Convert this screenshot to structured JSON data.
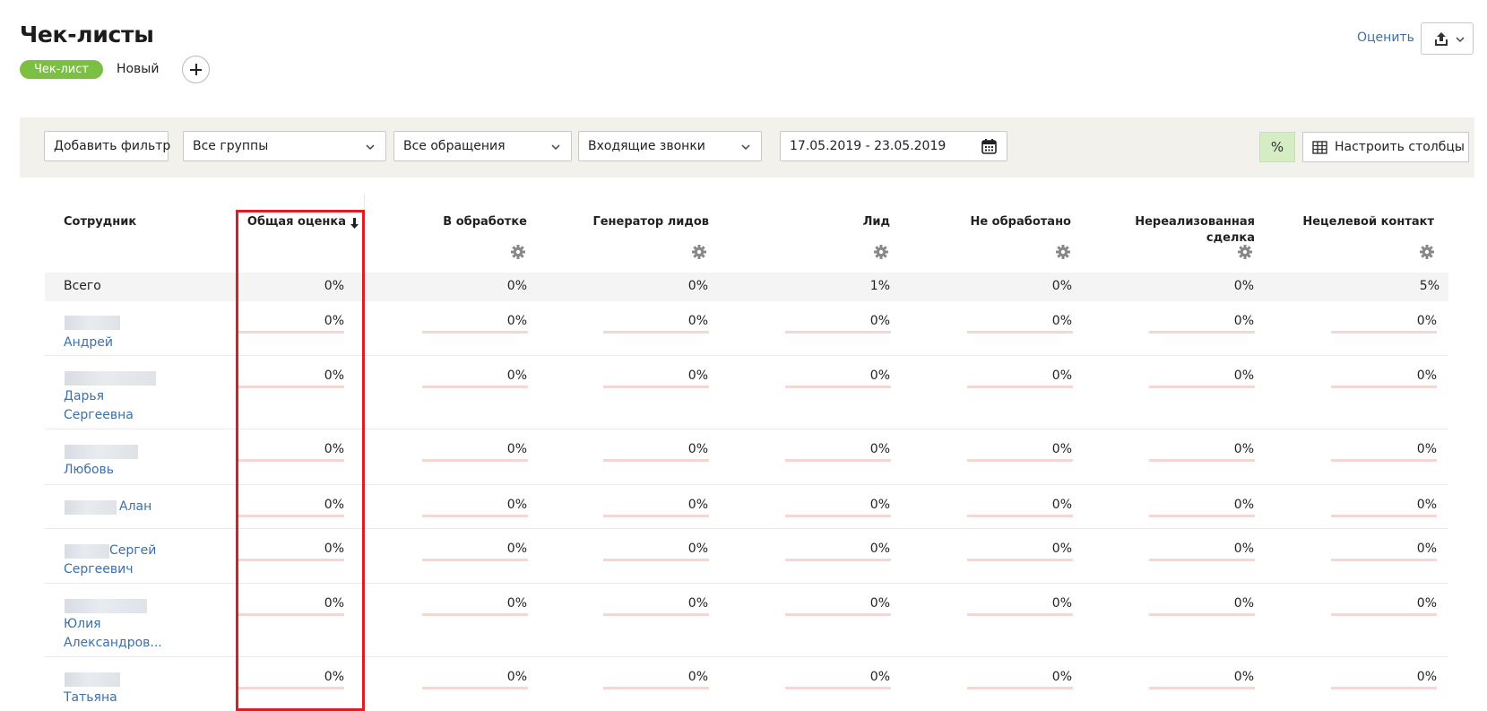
{
  "page": {
    "title": "Чек-листы",
    "tab_active": "Чек-лист",
    "tab_new": "Новый"
  },
  "header_actions": {
    "rate_label": "Оценить",
    "export_icon": "share-export-icon"
  },
  "filters": {
    "add_filter": "Добавить фильтр",
    "groups": "Все группы",
    "requests": "Все обращения",
    "call_type": "Входящие звонки",
    "date_range": "17.05.2019 - 23.05.2019",
    "percent": "%",
    "configure_columns": "Настроить столбцы"
  },
  "table": {
    "employee_header": "Сотрудник",
    "overall_header": "Общая оценка",
    "columns": [
      "В обработке",
      "Генератор лидов",
      "Лид",
      "Не обработано",
      "Нереализованная сделка",
      "Нецелевой контакт"
    ],
    "total": {
      "label": "Всего",
      "overall": "0%",
      "values": [
        "0%",
        "0%",
        "1%",
        "0%",
        "0%",
        "5%"
      ]
    },
    "rows": [
      {
        "name": "Андрей",
        "overall": "0%",
        "values": [
          "0%",
          "0%",
          "0%",
          "0%",
          "0%",
          "0%"
        ]
      },
      {
        "name": "Дарья",
        "name2": "Сергеевна",
        "overall": "0%",
        "values": [
          "0%",
          "0%",
          "0%",
          "0%",
          "0%",
          "0%"
        ]
      },
      {
        "name": "Любовь",
        "overall": "0%",
        "values": [
          "0%",
          "0%",
          "0%",
          "0%",
          "0%",
          "0%"
        ]
      },
      {
        "name": "Алан",
        "overall": "0%",
        "values": [
          "0%",
          "0%",
          "0%",
          "0%",
          "0%",
          "0%"
        ]
      },
      {
        "name": "Сергей",
        "name2": "Сергеевич",
        "overall": "0%",
        "values": [
          "0%",
          "0%",
          "0%",
          "0%",
          "0%",
          "0%"
        ]
      },
      {
        "name": "Юлия",
        "name2": "Александров...",
        "overall": "0%",
        "values": [
          "0%",
          "0%",
          "0%",
          "0%",
          "0%",
          "0%"
        ]
      },
      {
        "name": "Татьяна",
        "overall": "0%",
        "values": [
          "0%",
          "0%",
          "0%",
          "0%",
          "0%",
          "0%"
        ]
      }
    ]
  },
  "colors": {
    "accent_green": "#7bc043",
    "link_blue": "#3d6fa8",
    "highlight_red": "#dd1d23",
    "bar_pink": "#f5d6d2",
    "filter_bar_bg": "#f2f1ec"
  }
}
